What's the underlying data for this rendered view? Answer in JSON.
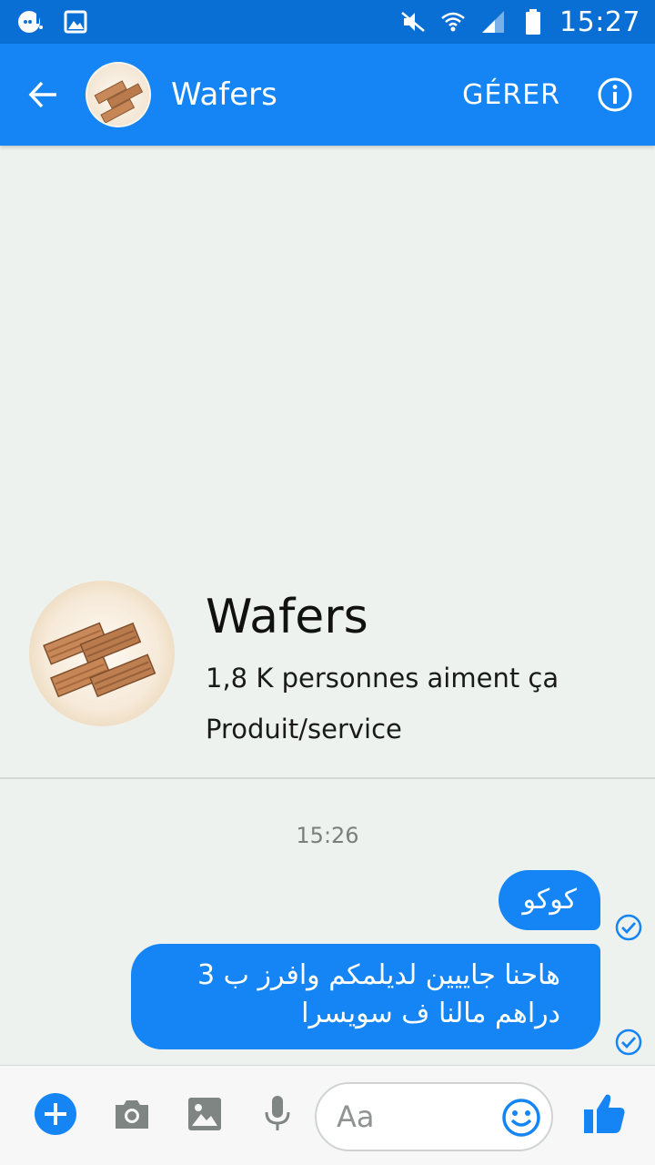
{
  "status_bar": {
    "time": "15:27",
    "icons": [
      "messenger-notification-icon",
      "gallery-notification-icon",
      "mute-icon",
      "wifi-icon",
      "signal-icon",
      "battery-icon"
    ]
  },
  "header": {
    "title": "Wafers",
    "manage_label": "GÉRER",
    "avatar_icon": "wafer-avatar"
  },
  "page_card": {
    "name": "Wafers",
    "likes": "1,8 K personnes aiment ça",
    "category": "Produit/service"
  },
  "conversation": {
    "timestamp": "15:26",
    "messages": [
      {
        "text": "كوكو",
        "status": "sent-check-icon"
      },
      {
        "text": "هاحنا جاييين لديلمكم وافرز ب 3 دراهم مالنا ف سويسرا",
        "status": "sent-check-icon"
      }
    ]
  },
  "composer": {
    "placeholder": "Aa",
    "icons": [
      "plus-icon",
      "camera-icon",
      "image-icon",
      "microphone-icon",
      "emoji-icon",
      "thumbs-up-icon"
    ]
  },
  "colors": {
    "status_bar": "#0a6fd4",
    "app_bar": "#1585f5",
    "bubble": "#1585f5",
    "background": "#eef2ef"
  }
}
